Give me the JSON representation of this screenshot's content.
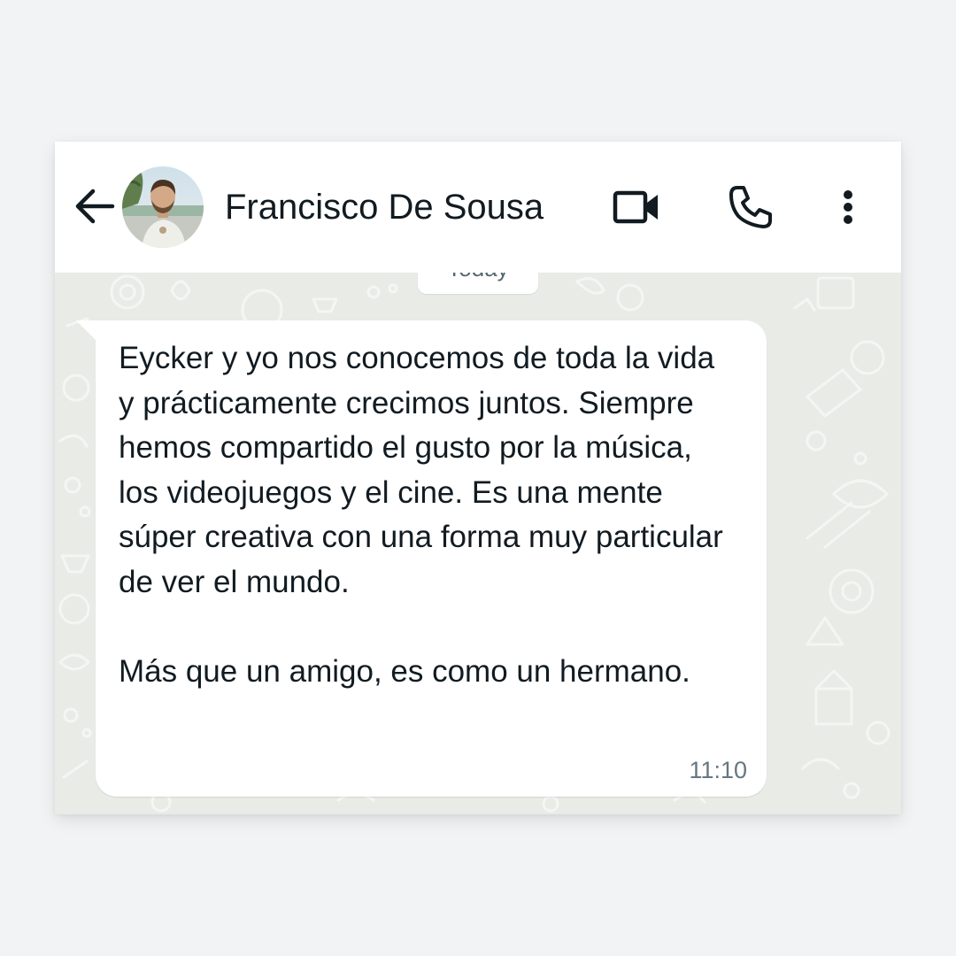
{
  "header": {
    "contact_name": "Francisco De Sousa",
    "icons": {
      "back": "arrow-left-icon",
      "avatar": "avatar",
      "video": "video-camera-icon",
      "call": "phone-icon",
      "menu": "more-vertical-icon"
    }
  },
  "chat": {
    "date_separator": "Today",
    "messages": [
      {
        "direction": "incoming",
        "text": "Eycker y yo nos conocemos de toda la vida y prácticamente crecimos juntos. Siempre hemos compartido el gusto por la música, los videojuegos y el cine. Es una mente súper creativa con una forma muy particular de ver el mundo.\n\nMás que un amigo, es como un hermano.",
        "time": "11:10"
      }
    ]
  },
  "colors": {
    "page_background": "#f2f3f5",
    "header_background": "#ffffff",
    "chat_wallpaper": "#e8ebe6",
    "bubble_background": "#ffffff",
    "text_primary": "#111b21",
    "text_secondary": "#667781"
  }
}
